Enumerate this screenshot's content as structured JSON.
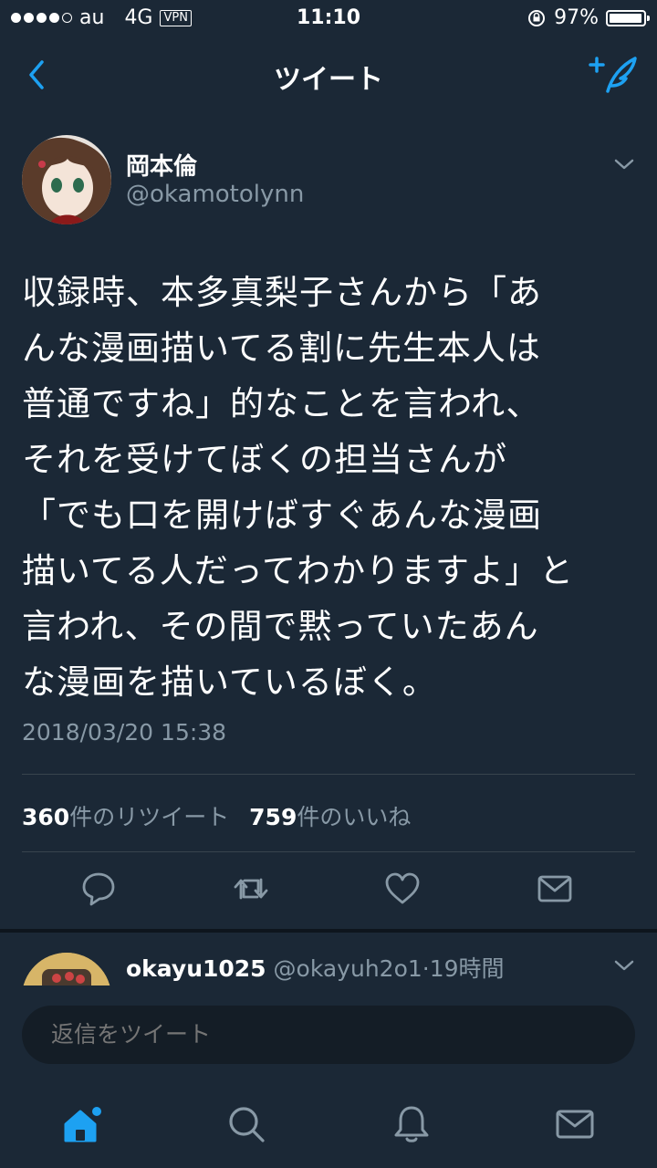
{
  "status_bar": {
    "carrier": "au",
    "network": "4G",
    "vpn": "VPN",
    "time": "11:10",
    "battery": "97%",
    "battery_level": 0.97
  },
  "nav": {
    "title": "ツイート"
  },
  "tweet": {
    "author_name": "岡本倫",
    "author_handle": "@okamotolynn",
    "text": "収録時、本多真梨子さんから「あ\nんな漫画描いてる割に先生本人は\n普通ですね」的なことを言われ、\nそれを受けてぼくの担当さんが\n「でも口を開けばすぐあんな漫画\n描いてる人だってわかりますよ」と\n言われ、その間で黙っていたあん\nな漫画を描いているぼく。",
    "timestamp": "2018/03/20 15:38",
    "retweet_count": "360",
    "retweet_label": "件のリツイート",
    "like_count": "759",
    "like_label": "件のいいね"
  },
  "reply": {
    "name": "okayu1025",
    "handle": "@okayuh2o1",
    "separator": "·",
    "time": "19時間"
  },
  "composer": {
    "placeholder": "返信をツイート"
  },
  "colors": {
    "accent": "#1da1f2",
    "background": "#141d26",
    "surface": "#1b2836",
    "secondary_text": "#8899a6"
  }
}
